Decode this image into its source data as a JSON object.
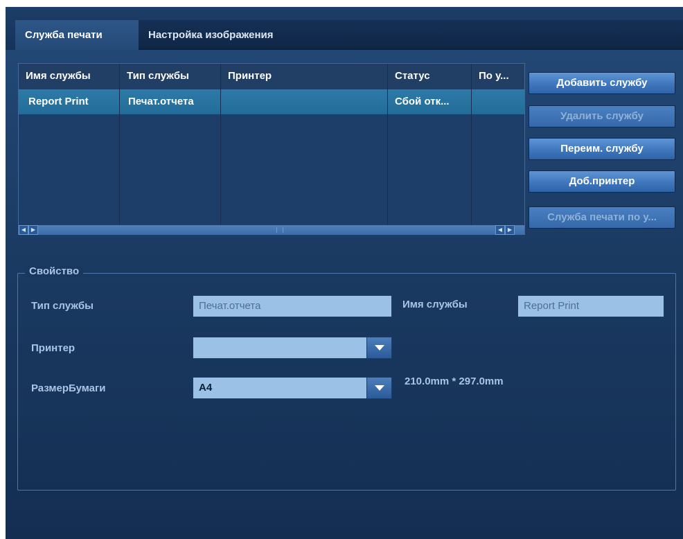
{
  "tabs": [
    {
      "label": "Служба печати",
      "active": true
    },
    {
      "label": "Настройка изображения",
      "active": false
    }
  ],
  "table": {
    "columns": [
      "Имя службы",
      "Тип службы",
      "Принтер",
      "Статус",
      "По у..."
    ],
    "rows": [
      [
        "Report Print",
        "Печат.отчета",
        "",
        "Сбой отк...",
        ""
      ]
    ]
  },
  "buttons": {
    "add_service": "Добавить службу",
    "delete_service": "Удалить службу",
    "rename_service": "Переим. службу",
    "add_printer": "Доб.принтер",
    "default_print_service": "Служба печати по у..."
  },
  "properties": {
    "title": "Свойство",
    "service_type_label": "Тип службы",
    "service_type_value": "Печат.отчета",
    "service_name_label": "Имя службы",
    "service_name_value": "Report Print",
    "printer_label": "Принтер",
    "printer_value": "",
    "paper_size_label": "РазмерБумаги",
    "paper_size_value": "A4",
    "paper_dimensions": "210.0mm * 297.0mm"
  },
  "colors": {
    "background": "#1b3b63",
    "selected_row": "#2a76a4",
    "button": "#4a82c6",
    "field": "#9bc2e6"
  },
  "icons": [
    "scroll-left-arrow-icon",
    "scroll-right-arrow-icon",
    "chevron-down-icon"
  ]
}
